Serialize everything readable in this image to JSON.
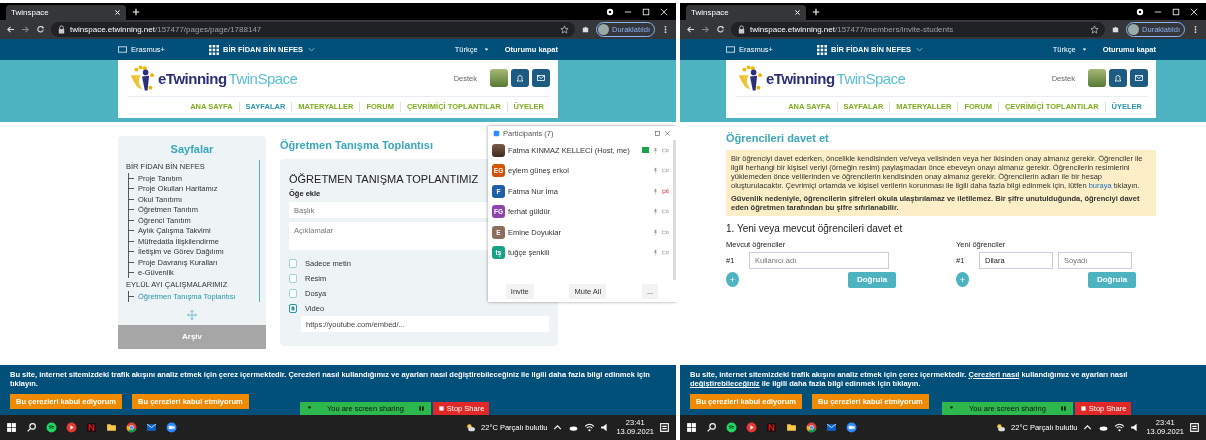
{
  "screens": [
    {
      "kind": "pages",
      "browser": {
        "tab_title": "Twinspace",
        "url_host": "twinspace.etwinning.net",
        "url_path": "/157477/pages/page/1788147",
        "profile": "Duraklatıldı"
      },
      "site": {
        "program": "Erasmus+",
        "project": "BİR FİDAN BİN NEFES",
        "language": "Türkçe",
        "logout": "Oturumu kapat",
        "logo_main": "eTwinning",
        "logo_sub": "TwinSpace",
        "support": "Destek",
        "nav": [
          {
            "label": "ANA SAYFA",
            "selected": false
          },
          {
            "label": "SAYFALAR",
            "selected": true
          },
          {
            "label": "MATERYALLER",
            "selected": false
          },
          {
            "label": "FORUM",
            "selected": false
          },
          {
            "label": "ÇEVRİMİÇİ TOPLANTILAR",
            "selected": false
          },
          {
            "label": "ÜYELER",
            "selected": false
          }
        ]
      },
      "sidebar": {
        "title": "Sayfalar",
        "archive": "Arşiv",
        "groups": [
          {
            "label": "BİR FİDAN BİN NEFES",
            "children": [
              {
                "label": "Proje Tanıtım",
                "selected": false
              },
              {
                "label": "Proje Okulları Haritamız",
                "selected": false
              },
              {
                "label": "Okul Tanıtımı",
                "selected": false
              },
              {
                "label": "Öğretmen Tanıtım",
                "selected": false
              },
              {
                "label": "Öğrenci Tanıtım",
                "selected": false
              },
              {
                "label": "Aylık Çalışma Takvimi",
                "selected": false
              },
              {
                "label": "Müfredatla İlişkilendirme",
                "selected": false
              },
              {
                "label": "İletişim ve Görev Dağılımı",
                "selected": false
              },
              {
                "label": "Proje Davranış Kuralları",
                "selected": false
              },
              {
                "label": "e-Güvenlik",
                "selected": false
              }
            ]
          },
          {
            "label": "EYLÜL AYI ÇALIŞMALARIMIZ",
            "children": [
              {
                "label": "Öğretmen Tanışma Toplantısı",
                "selected": true
              }
            ]
          }
        ]
      },
      "page": {
        "title": "Öğretmen Tanışma Toplantısı",
        "heading": "ÖĞRETMEN TANIŞMA TOPLANTIMIZ",
        "add_label": "Öğe ekle",
        "title_placeholder": "Başlık",
        "desc_placeholder": "Açıklamalar",
        "options": [
          {
            "label": "Sadece metin",
            "selected": false
          },
          {
            "label": "Resim",
            "selected": false
          },
          {
            "label": "Dosya",
            "selected": false
          },
          {
            "label": "Video",
            "selected": true
          }
        ],
        "video_url": "https://youtube.com/embed/..."
      },
      "participants": {
        "title": "Participants (7)",
        "buttons": [
          "Invite",
          "Mute All",
          "..."
        ],
        "people": [
          {
            "name": "Fatma KINMAZ KELLECİ (Host, me)",
            "sharing": true,
            "video_blocked": false
          },
          {
            "initials": "EG",
            "color": "#d35400",
            "name": "eylem güneş erkol",
            "sharing": false,
            "video_blocked": false
          },
          {
            "initials": "F",
            "color": "#1f5fa8",
            "name": "Fatma Nur İma",
            "sharing": false,
            "video_blocked": true
          },
          {
            "initials": "FG",
            "color": "#8e44ad",
            "name": "ferhat güldür",
            "sharing": false,
            "video_blocked": false
          },
          {
            "initials": "E",
            "color": "#8b6e5e",
            "name": "Emine Doyuklar",
            "sharing": false,
            "video_blocked": false
          },
          {
            "initials": "tş",
            "color": "#1aa086",
            "name": "tuğçe şenkili",
            "sharing": false,
            "video_blocked": false
          }
        ]
      },
      "cookie": {
        "parts": [
          {
            "text": "Bu site, internet sitemizdeki trafik akışını analiz etmek için çerez içermektedir. Çerezleri nasıl kullandığımız ve ayarları nasıl değiştirebileceğiniz ile ilgili daha fazla bilgi edinmek için tıklayın.",
            "link": false
          }
        ],
        "buttons": [
          "Bu çerezleri kabul ediyorum",
          "Bu çerezleri kabul etmiyorum"
        ]
      },
      "share_bar": {
        "label": "You are screen sharing",
        "stop": "Stop Share"
      },
      "taskbar": {
        "weather": "22°C Parçalı bulutlu",
        "time": "23:41",
        "date": "13.09.2021"
      }
    },
    {
      "kind": "invite",
      "browser": {
        "tab_title": "Twinspace",
        "url_host": "twinspace.etwinning.net",
        "url_path": "/157477/members/invite-students",
        "profile": "Duraklatıldı"
      },
      "site": {
        "program": "Erasmus+",
        "project": "BİR FİDAN BİN NEFES",
        "language": "Türkçe",
        "logout": "Oturumu kapat",
        "logo_main": "eTwinning",
        "logo_sub": "TwinSpace",
        "support": "Destek",
        "nav": [
          {
            "label": "ANA SAYFA",
            "selected": false
          },
          {
            "label": "SAYFALAR",
            "selected": false
          },
          {
            "label": "MATERYALLER",
            "selected": false
          },
          {
            "label": "FORUM",
            "selected": false
          },
          {
            "label": "ÇEVRİMİÇİ TOPLANTILAR",
            "selected": false
          },
          {
            "label": "ÜYELER",
            "selected": true
          }
        ]
      },
      "invite": {
        "title": "Öğrencileri davet et",
        "notice": "Bir öğrenciyi davet ederken, öncelikle kendisinden ve/veya velisinden veya her ikisinden onay almanız gerekir. Öğrenciler ile ilgili herhangi bir kişisel veriyi (örneğin resim) paylaşmadan önce ebeveyn onayı almanız gerekir. Öğrencilerin resimlerini yüklemeden önce velilerinden ve öğrencilerin kendisinden onay almanız gerekir. Öğrencilerin adları ile bir hesap oluşturulacaktır. Çevrimiçi ortamda ve kişisel verilerin korunması ile ilgili daha fazla bilgi edinmek için, lütfen",
        "notice_link": "buraya",
        "notice_end": "tıklayın.",
        "security": "Güvenlik nedeniyle, öğrencilerin şifreleri okula ulaştırılamaz ve iletilemez. Bir şifre unutulduğunda, öğrenciyi davet eden öğretmen tarafından bu şifre sıfırlanabilir.",
        "heading": "1. Yeni veya mevcut öğrencileri davet et",
        "existing": {
          "label": "Mevcut öğrenciler",
          "number": "#1",
          "placeholder": "Kullanıcı adı",
          "add": "+",
          "verify": "Doğrula"
        },
        "new": {
          "label": "Yeni öğrenciler",
          "number": "#1",
          "first_name": "Dilara",
          "placeholder": "Soyadı",
          "add": "+",
          "verify": "Doğrula"
        }
      },
      "cookie": {
        "parts": [
          {
            "text": "Bu site, internet sitemizdeki trafik akışını analiz etmek için çerez içermektedir.",
            "link": false
          },
          {
            "text": "Çerezleri nasıl",
            "link": true
          },
          {
            "text": "kullandığımız ve ayarları nasıl",
            "link": false
          },
          {
            "text": "değiştirebileceğiniz",
            "link": true
          },
          {
            "text": "ile ilgili daha fazla bilgi edinmek için tıklayın.",
            "link": false
          }
        ],
        "buttons": [
          "Bu çerezleri kabul ediyorum",
          "Bu çerezleri kabul etmiyorum"
        ]
      },
      "share_bar": {
        "label": "You are screen sharing",
        "stop": "Stop Share"
      },
      "taskbar": {
        "weather": "22°C Parçalı bulutlu",
        "time": "23:41",
        "date": "13.09.2021"
      }
    }
  ]
}
